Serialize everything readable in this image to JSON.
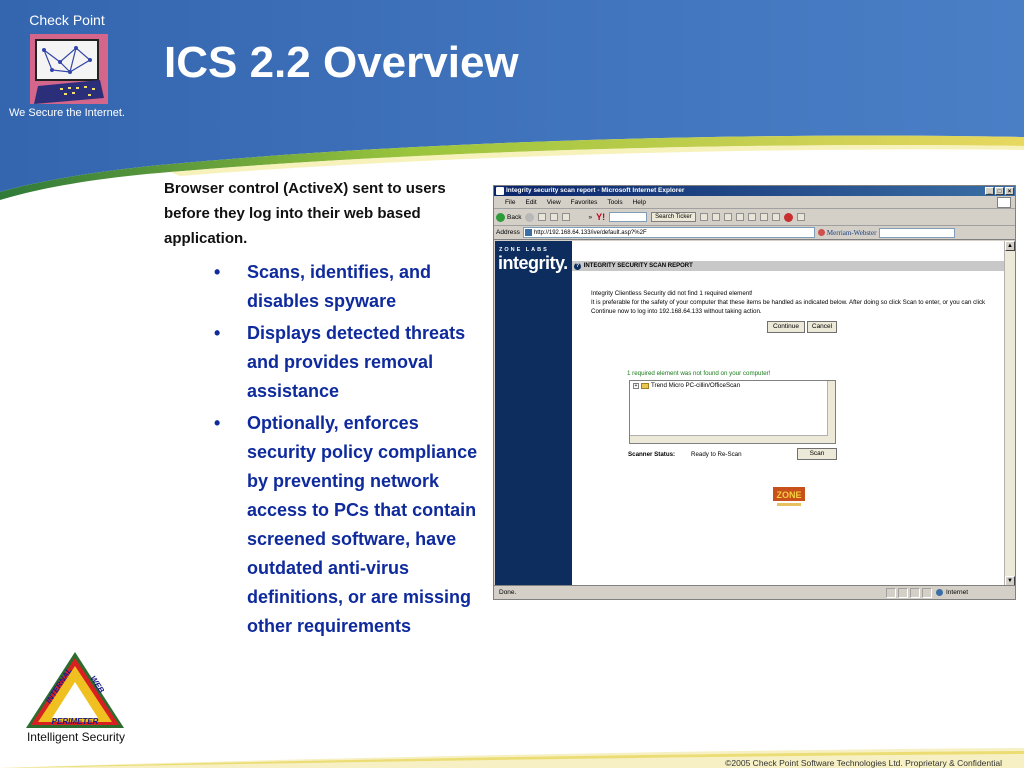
{
  "brand": {
    "name": "Check Point",
    "tagline": "We Secure the Internet."
  },
  "slide": {
    "title": "ICS 2.2 Overview",
    "intro": "Browser control (ActiveX) sent to users before they log into their web based application.",
    "bullets": [
      "Scans, identifies, and disables spyware",
      "Displays detected threats and provides removal assistance",
      "Optionally, enforces security policy compliance by preventing network access to PCs that contain screened software, have outdated anti-virus definitions, or are missing other requirements"
    ],
    "bullet_glyph": "•"
  },
  "browser": {
    "window_title": "Integrity security scan report - Microsoft Internet Explorer",
    "window_controls": [
      "_",
      "□",
      "×"
    ],
    "menu": [
      "File",
      "Edit",
      "View",
      "Favorites",
      "Tools",
      "Help"
    ],
    "toolbar": {
      "back": "Back",
      "search_button": "Search Ticker",
      "chevron": "»"
    },
    "address": {
      "label": "Address",
      "url": "http://192.168.64.133/ive/default.asp?%2F",
      "dictionary": "Merriam-Webster"
    },
    "page": {
      "zone_labs": "ZONE LABS",
      "product": "integrity.",
      "section_header": "INTEGRITY SECURITY SCAN REPORT",
      "message_line1": "Integrity Clientless Security did not find 1 required element!",
      "message_line2": "It is preferable for the safety of your computer that these items be handled as indicated below. After doing so click Scan to enter, or you can click",
      "message_line3": "Continue now to log into 192.168.64.133 without taking action.",
      "continue_button": "Continue",
      "cancel_button": "Cancel",
      "required_notice": "1 required element was not found on your computer!",
      "tree_item": "Trend Micro PC-cillin/OfficeScan",
      "scanner_status_label": "Scanner Status:",
      "scanner_status_value": "Ready to Re-Scan",
      "scan_button": "Scan",
      "zone_logo_text": "ZONE"
    },
    "status_bar": {
      "text": "Done.",
      "zone": "Internet"
    }
  },
  "footer": {
    "security_label": "Intelligent Security",
    "triangle_labels": [
      "INTERNAL",
      "WEB",
      "PERIMETER"
    ],
    "copyright": "©2005 Check Point Software Technologies Ltd. Proprietary & Confidential"
  },
  "colors": {
    "header_blue": "#3c6fb4",
    "bullet_blue": "#0e2a9c",
    "swoosh_green": "#9ac43c",
    "swoosh_yellow": "#e8d860",
    "integrity_navy": "#0c2d5e"
  }
}
